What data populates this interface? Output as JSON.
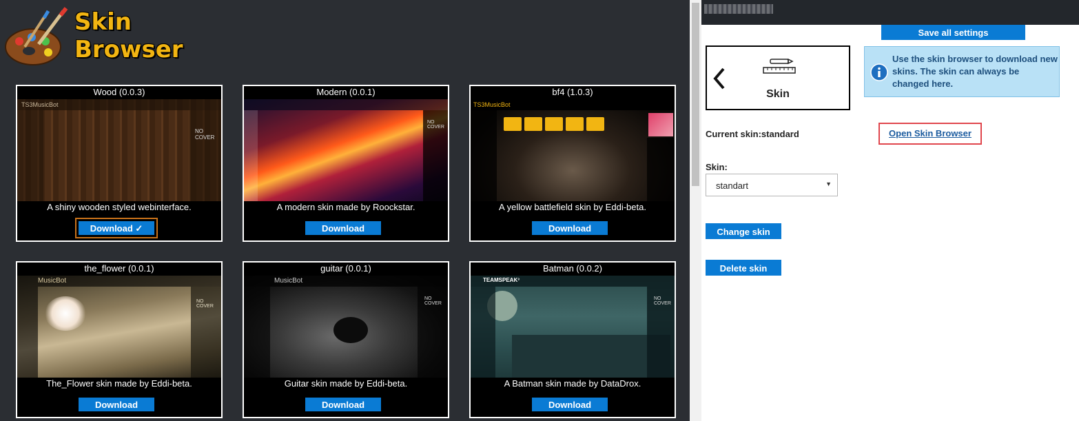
{
  "browser": {
    "logo_line1": "Skin",
    "logo_line2": "Browser",
    "skins": [
      {
        "title": "Wood (0.0.3)",
        "description": "A shiny wooden styled webinterface.",
        "button": "Download ✓",
        "installed": true
      },
      {
        "title": "Modern (0.0.1)",
        "description": "A modern skin made by Roockstar.",
        "button": "Download",
        "installed": false
      },
      {
        "title": "bf4 (1.0.3)",
        "description": "A yellow battlefield skin by Eddi-beta.",
        "button": "Download",
        "installed": false
      },
      {
        "title": "the_flower (0.0.1)",
        "description": "The_Flower skin made by Eddi-beta.",
        "button": "Download",
        "installed": false
      },
      {
        "title": "guitar (0.0.1)",
        "description": "Guitar skin made by Eddi-beta.",
        "button": "Download",
        "installed": false
      },
      {
        "title": "Batman (0.0.2)",
        "description": "A Batman skin made by DataDrox.",
        "button": "Download",
        "installed": false
      }
    ],
    "preview_text": {
      "ts3musicbot": "TS3MusicBot",
      "no_cover": "NO COVER",
      "musicbot": "MusicBot",
      "teamspeak": "TEAMSPEAK³"
    }
  },
  "settings": {
    "save_all": "Save all settings",
    "tile_label": "Skin",
    "info": "Use the skin browser to download new skins. The skin can always be changed here.",
    "current_skin": "Current skin:standard",
    "open_browser": "Open Skin Browser",
    "skin_label": "Skin:",
    "skin_value": "standart",
    "change_skin": "Change skin",
    "delete_skin": "Delete skin"
  },
  "colors": {
    "accent": "#0a7bd4",
    "logo": "#f2b512",
    "highlight": "#e0454c",
    "info_bg": "#b9e1f6"
  }
}
